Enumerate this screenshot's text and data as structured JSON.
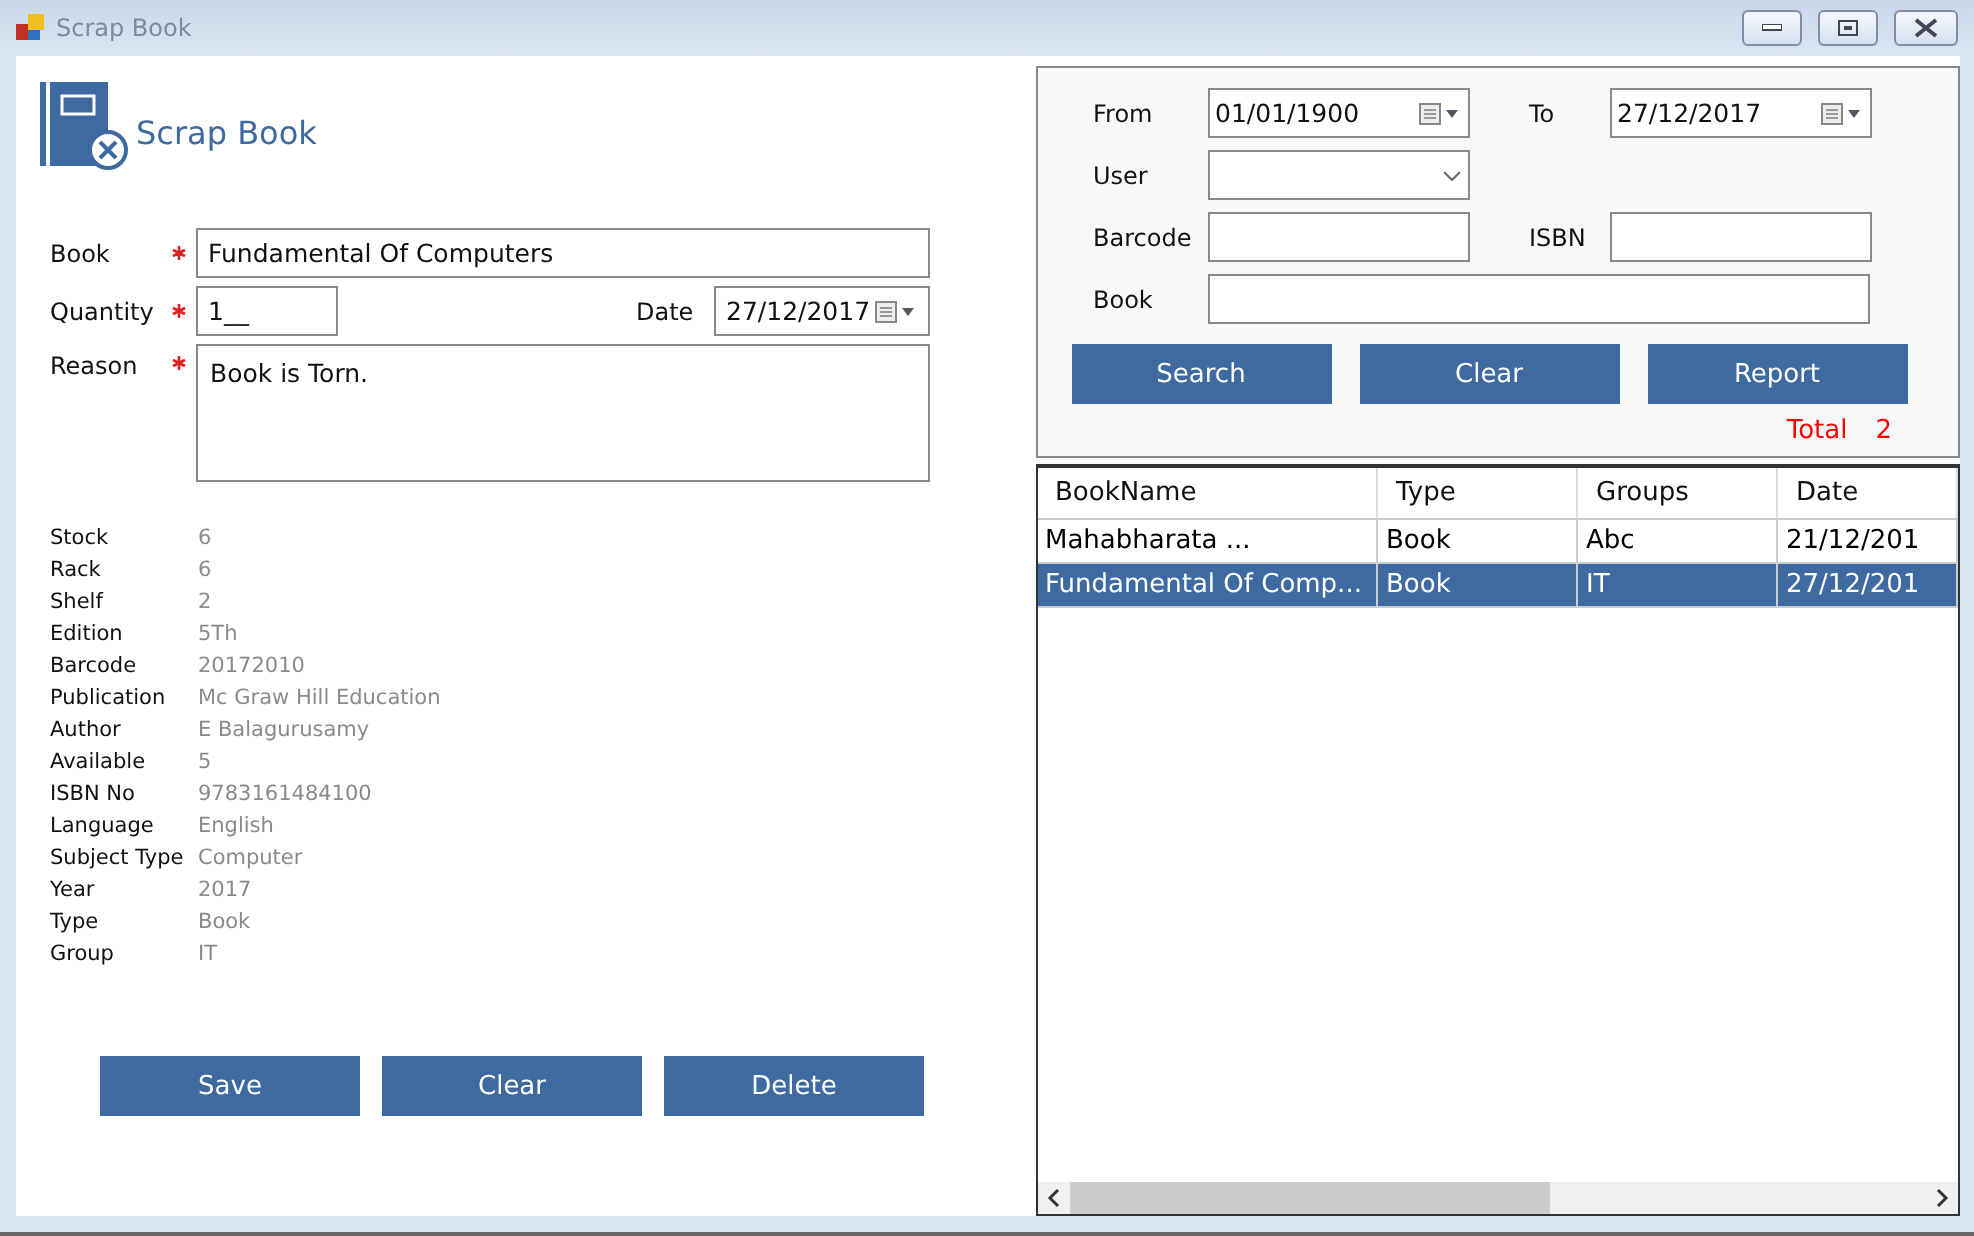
{
  "window": {
    "title": "Scrap Book"
  },
  "header": {
    "title": "Scrap Book"
  },
  "form": {
    "book": {
      "label": "Book",
      "required": true,
      "value": "Fundamental Of Computers"
    },
    "quantity": {
      "label": "Quantity",
      "required": true,
      "value": "1__"
    },
    "date": {
      "label": "Date",
      "value": "27/12/2017"
    },
    "reason": {
      "label": "Reason",
      "required": true,
      "value": "Book is Torn."
    }
  },
  "details": [
    {
      "label": "Stock",
      "value": "6"
    },
    {
      "label": "Rack",
      "value": "6"
    },
    {
      "label": "Shelf",
      "value": "2"
    },
    {
      "label": "Edition",
      "value": "5Th"
    },
    {
      "label": "Barcode",
      "value": "20172010"
    },
    {
      "label": "Publication",
      "value": "Mc Graw Hill Education"
    },
    {
      "label": "Author",
      "value": "E Balagurusamy"
    },
    {
      "label": "Available",
      "value": "5"
    },
    {
      "label": "ISBN No",
      "value": "9783161484100"
    },
    {
      "label": "Language",
      "value": "English"
    },
    {
      "label": "Subject Type",
      "value": "Computer"
    },
    {
      "label": "Year",
      "value": "2017"
    },
    {
      "label": "Type",
      "value": "Book"
    },
    {
      "label": "Group",
      "value": "IT"
    }
  ],
  "form_buttons": [
    "Save",
    "Clear",
    "Delete"
  ],
  "filter": {
    "from": {
      "label": "From",
      "value": "01/01/1900"
    },
    "to": {
      "label": "To",
      "value": "27/12/2017"
    },
    "user": {
      "label": "User"
    },
    "barcode": {
      "label": "Barcode"
    },
    "isbn": {
      "label": "ISBN"
    },
    "book": {
      "label": "Book"
    }
  },
  "filter_buttons": [
    "Search",
    "Clear",
    "Report"
  ],
  "total": {
    "label": "Total",
    "value": "2"
  },
  "table": {
    "columns": [
      "BookName",
      "Type",
      "Groups",
      "Date"
    ],
    "rows": [
      {
        "cells": [
          "Mahabharata ...",
          "Book",
          "Abc",
          "21/12/201"
        ],
        "selected": false
      },
      {
        "cells": [
          "Fundamental Of Comp...",
          "Book",
          "IT",
          "27/12/201"
        ],
        "selected": true
      }
    ]
  }
}
